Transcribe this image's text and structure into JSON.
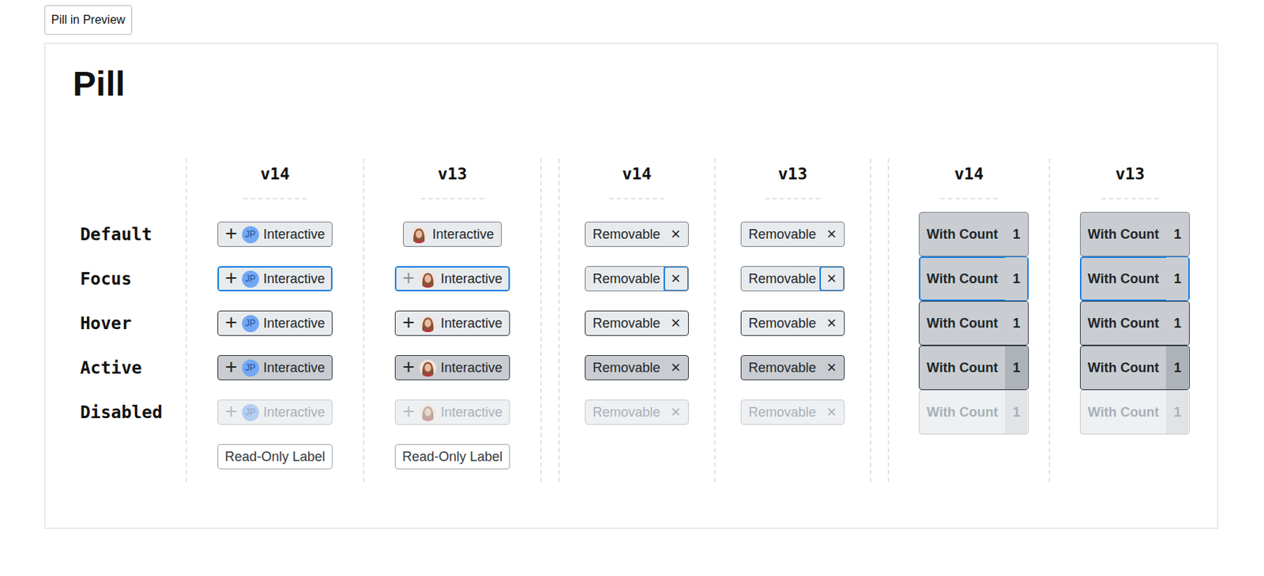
{
  "button": "Pill in Preview",
  "title": "Pill",
  "rows": [
    "Default",
    "Focus",
    "Hover",
    "Active",
    "Disabled"
  ],
  "groups": [
    {
      "columns": [
        {
          "header": "v14",
          "cells": [
            {
              "state": "default",
              "kind": "interactive",
              "icon": "+",
              "avatar": {
                "kind": "initials",
                "text": "JP"
              },
              "label": "Interactive"
            },
            {
              "state": "focus",
              "kind": "interactive",
              "icon": "+",
              "avatar": {
                "kind": "initials",
                "text": "JP"
              },
              "label": "Interactive"
            },
            {
              "state": "hover",
              "kind": "interactive",
              "icon": "+",
              "avatar": {
                "kind": "initials",
                "text": "JP"
              },
              "label": "Interactive"
            },
            {
              "state": "active",
              "kind": "interactive",
              "icon": "+",
              "avatar": {
                "kind": "initials",
                "text": "JP"
              },
              "label": "Interactive"
            },
            {
              "state": "disabled",
              "kind": "interactive",
              "icon": "+",
              "avatar": {
                "kind": "initials",
                "text": "JP"
              },
              "label": "Interactive"
            },
            {
              "state": "readonly",
              "kind": "label",
              "label": "Read-Only Label"
            }
          ]
        },
        {
          "header": "v13",
          "cells": [
            {
              "state": "default",
              "kind": "interactive",
              "avatar": {
                "kind": "photo"
              },
              "label": "Interactive"
            },
            {
              "state": "focus",
              "kind": "interactive",
              "icon": "+",
              "iconMuted": true,
              "avatar": {
                "kind": "photo"
              },
              "label": "Interactive"
            },
            {
              "state": "hover",
              "kind": "interactive",
              "icon": "+",
              "avatar": {
                "kind": "photo"
              },
              "label": "Interactive"
            },
            {
              "state": "active",
              "kind": "interactive",
              "icon": "+",
              "avatar": {
                "kind": "photo"
              },
              "label": "Interactive"
            },
            {
              "state": "disabled",
              "kind": "interactive",
              "icon": "+",
              "avatar": {
                "kind": "photo"
              },
              "label": "Interactive"
            },
            {
              "state": "readonly",
              "kind": "label",
              "label": "Read-Only Label"
            }
          ]
        }
      ]
    },
    {
      "columns": [
        {
          "header": "v14",
          "cells": [
            {
              "state": "default",
              "kind": "removable",
              "label": "Removable",
              "remove": "×"
            },
            {
              "state": "focus",
              "kind": "removable",
              "label": "Removable",
              "remove": "×"
            },
            {
              "state": "hover",
              "kind": "removable",
              "label": "Removable",
              "remove": "×"
            },
            {
              "state": "active",
              "kind": "removable",
              "label": "Removable",
              "remove": "×"
            },
            {
              "state": "disabled",
              "kind": "removable",
              "label": "Removable",
              "remove": "×"
            }
          ]
        },
        {
          "header": "v13",
          "cells": [
            {
              "state": "default",
              "kind": "removable",
              "label": "Removable",
              "remove": "×"
            },
            {
              "state": "focus",
              "kind": "removable",
              "label": "Removable",
              "remove": "×"
            },
            {
              "state": "hover",
              "kind": "removable",
              "label": "Removable",
              "remove": "×"
            },
            {
              "state": "active",
              "kind": "removable",
              "label": "Removable",
              "remove": "×"
            },
            {
              "state": "disabled",
              "kind": "removable",
              "label": "Removable",
              "remove": "×"
            }
          ]
        }
      ]
    },
    {
      "columns": [
        {
          "header": "v14",
          "cells": [
            {
              "state": "default",
              "kind": "count",
              "label": "With Count",
              "count": "1"
            },
            {
              "state": "focus",
              "kind": "count",
              "label": "With Count",
              "count": "1"
            },
            {
              "state": "hover",
              "kind": "count",
              "label": "With Count",
              "count": "1"
            },
            {
              "state": "active",
              "kind": "count",
              "label": "With Count",
              "count": "1"
            },
            {
              "state": "disabled",
              "kind": "count",
              "label": "With Count",
              "count": "1"
            }
          ]
        },
        {
          "header": "v13",
          "cells": [
            {
              "state": "default",
              "kind": "count",
              "label": "With Count",
              "count": "1"
            },
            {
              "state": "focus",
              "kind": "count",
              "label": "With Count",
              "count": "1"
            },
            {
              "state": "hover",
              "kind": "count",
              "label": "With Count",
              "count": "1"
            },
            {
              "state": "active",
              "kind": "count",
              "label": "With Count",
              "count": "1"
            },
            {
              "state": "disabled",
              "kind": "count",
              "label": "With Count",
              "count": "1"
            }
          ]
        }
      ]
    }
  ]
}
